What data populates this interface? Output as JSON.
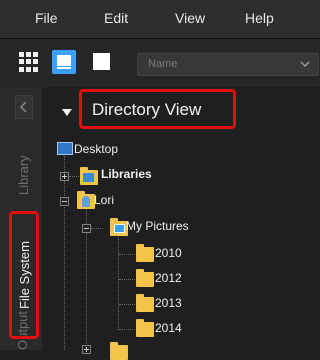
{
  "menu": {
    "file": "File",
    "edit": "Edit",
    "view": "View",
    "help": "Help"
  },
  "toolbar": {
    "sort_value": "Name"
  },
  "tabs": {
    "library": "Library",
    "file_system": "File System",
    "output": "Output"
  },
  "panel": {
    "title": "Directory View",
    "tree": {
      "desktop": "Desktop",
      "libraries": "Libraries",
      "user": "Lori",
      "my_pictures": "My Pictures",
      "years": [
        "2010",
        "2012",
        "2013",
        "2014"
      ]
    }
  },
  "colors": {
    "highlight": "#e01010",
    "accent": "#3aa0ff",
    "folder": "#f2c54a"
  }
}
